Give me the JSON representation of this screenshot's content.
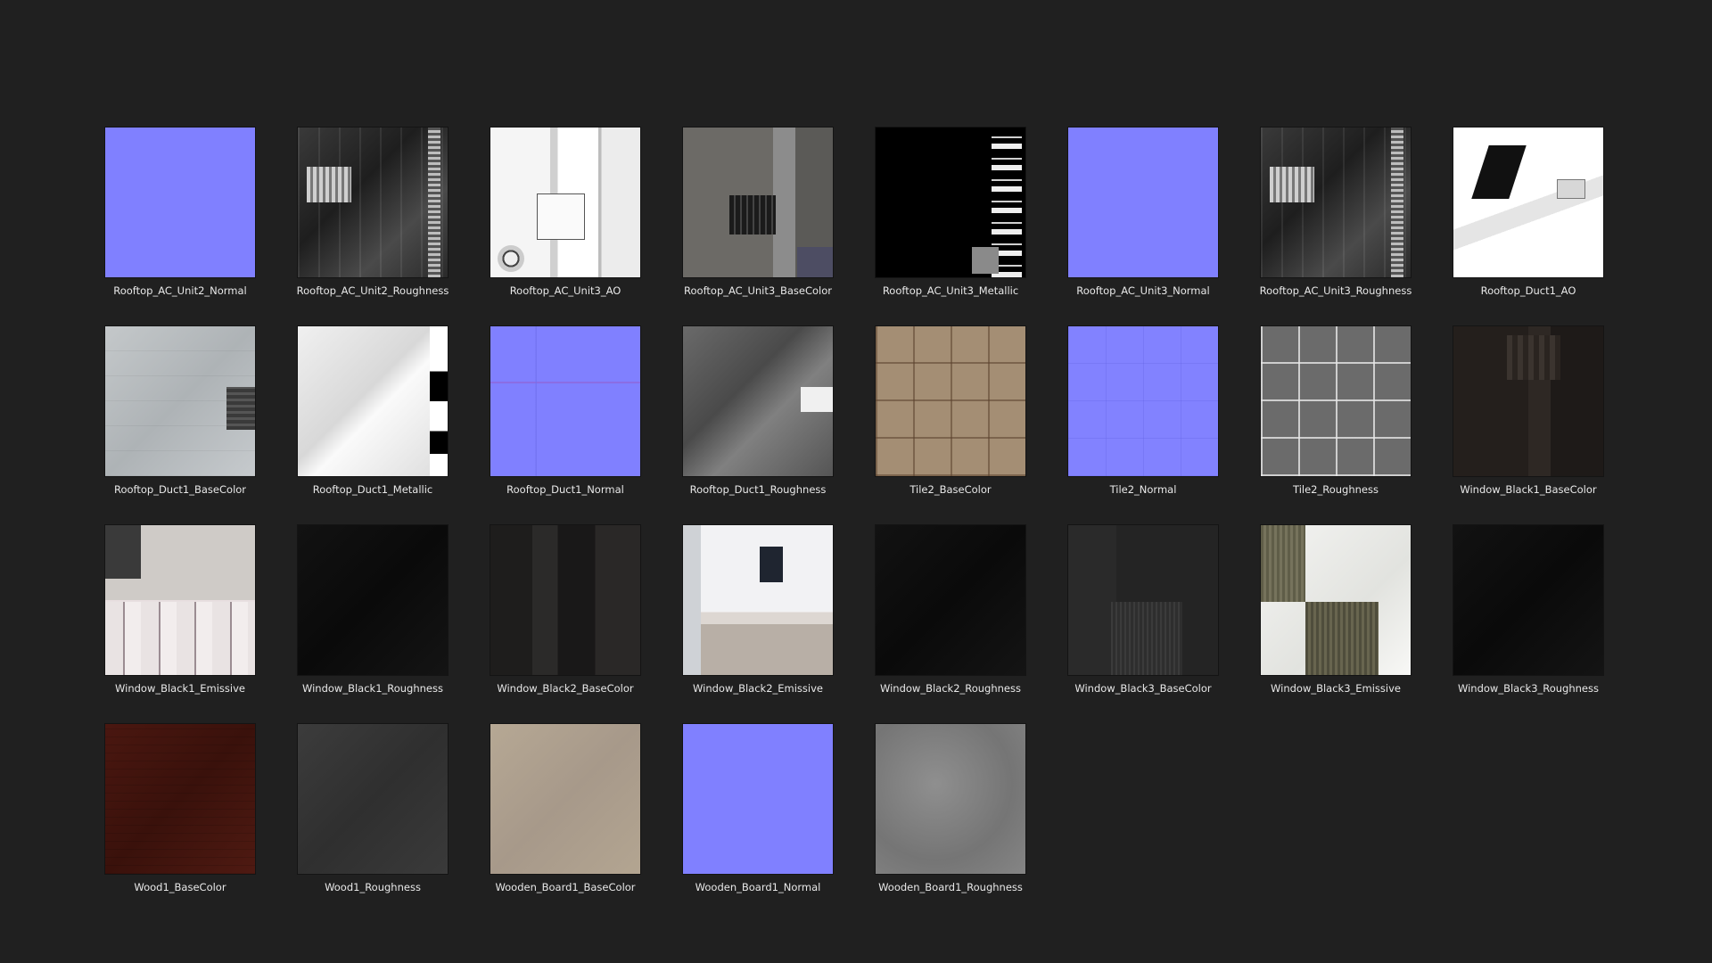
{
  "tiles": [
    {
      "label": "Rooftop_AC_Unit2_Normal",
      "style": "t-normal"
    },
    {
      "label": "Rooftop_AC_Unit2_Roughness",
      "style": "t-rough-dark"
    },
    {
      "label": "Rooftop_AC_Unit3_AO",
      "style": "t-ao-light"
    },
    {
      "label": "Rooftop_AC_Unit3_BaseColor",
      "style": "t-basecolor-roof"
    },
    {
      "label": "Rooftop_AC_Unit3_Metallic",
      "style": "t-metallic"
    },
    {
      "label": "Rooftop_AC_Unit3_Normal",
      "style": "t-normal"
    },
    {
      "label": "Rooftop_AC_Unit3_Roughness",
      "style": "t-rough-dark"
    },
    {
      "label": "Rooftop_Duct1_AO",
      "style": "t-ao-white"
    },
    {
      "label": "Rooftop_Duct1_BaseColor",
      "style": "t-duct-base"
    },
    {
      "label": "Rooftop_Duct1_Metallic",
      "style": "t-duct-metal"
    },
    {
      "label": "Rooftop_Duct1_Normal",
      "style": "t-normal-lines"
    },
    {
      "label": "Rooftop_Duct1_Roughness",
      "style": "t-duct-rough"
    },
    {
      "label": "Tile2_BaseColor",
      "style": "t-tile-base"
    },
    {
      "label": "Tile2_Normal",
      "style": "t-normal-grid"
    },
    {
      "label": "Tile2_Roughness",
      "style": "t-tile-rough"
    },
    {
      "label": "Window_Black1_BaseColor",
      "style": "t-window1-base"
    },
    {
      "label": "Window_Black1_Emissive",
      "style": "t-window1-emis"
    },
    {
      "label": "Window_Black1_Roughness",
      "style": "t-black"
    },
    {
      "label": "Window_Black2_BaseColor",
      "style": "t-window2-base"
    },
    {
      "label": "Window_Black2_Emissive",
      "style": "t-window2-emis"
    },
    {
      "label": "Window_Black2_Roughness",
      "style": "t-black"
    },
    {
      "label": "Window_Black3_BaseColor",
      "style": "t-window3-base"
    },
    {
      "label": "Window_Black3_Emissive",
      "style": "t-window3-emis"
    },
    {
      "label": "Window_Black3_Roughness",
      "style": "t-black"
    },
    {
      "label": "Wood1_BaseColor",
      "style": "t-wood-base"
    },
    {
      "label": "Wood1_Roughness",
      "style": "t-wood-rough"
    },
    {
      "label": "Wooden_Board1_BaseColor",
      "style": "t-board-base"
    },
    {
      "label": "Wooden_Board1_Normal",
      "style": "t-normal"
    },
    {
      "label": "Wooden_Board1_Roughness",
      "style": "t-board-rough"
    }
  ]
}
